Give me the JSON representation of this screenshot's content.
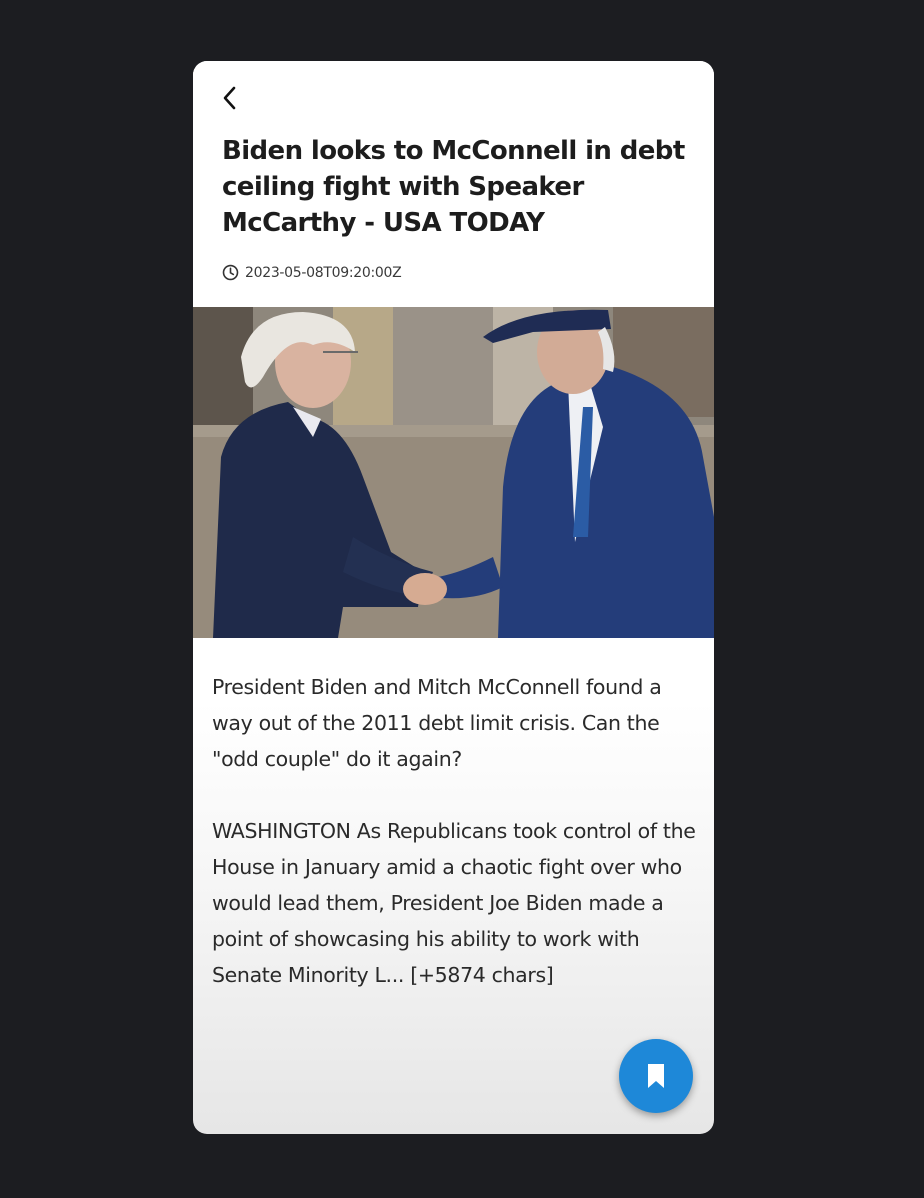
{
  "article": {
    "title": "Biden looks to McConnell in debt ceiling fight with Speaker McCarthy - USA TODAY",
    "published_at": "2023-05-08T09:20:00Z",
    "description": "President Biden and Mitch McConnell found a way out of the 2011 debt limit crisis. Can the \"odd couple\" do it again?",
    "content": "WASHINGTON As Republicans took control of the House in January amid a chaotic fight over who would lead them, President Joe Biden made a point of showcasing his ability to work with Senate Minority L... [+5874 chars]"
  },
  "icons": {
    "back": "chevron-left-icon",
    "time": "clock-icon",
    "save": "bookmark-icon"
  },
  "colors": {
    "background": "#1c1d21",
    "card": "#ffffff",
    "accent": "#1e88d8",
    "text": "#1d1d1d"
  }
}
